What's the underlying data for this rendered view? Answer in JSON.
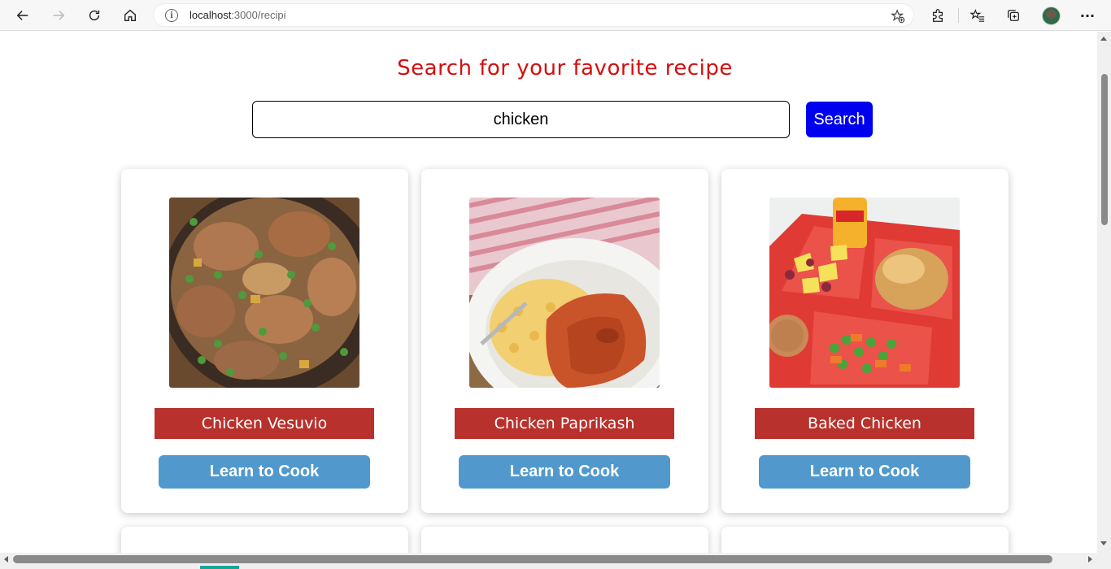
{
  "browser": {
    "url_host": "localhost",
    "url_path": ":3000/recipi",
    "nav_icons": [
      "back-arrow-icon",
      "forward-arrow-icon",
      "refresh-icon",
      "home-icon"
    ],
    "toolbar_icons": [
      "add-favorite-icon",
      "extensions-icon",
      "favorites-icon",
      "collections-icon",
      "profile-avatar",
      "more-icon"
    ],
    "more_label": "···"
  },
  "page": {
    "title": "Search for your favorite recipe",
    "title_color": "#d40f0f"
  },
  "search": {
    "value": "chicken",
    "button_label": "Search",
    "button_color": "#0000ee"
  },
  "recipes": [
    {
      "title": "Chicken Vesuvio",
      "button_label": "Learn to Cook",
      "image": "chicken-vesuvio-photo"
    },
    {
      "title": "Chicken Paprikash",
      "button_label": "Learn to Cook",
      "image": "chicken-paprikash-photo"
    },
    {
      "title": "Baked Chicken",
      "button_label": "Learn to Cook",
      "image": "baked-chicken-tray-photo"
    }
  ],
  "colors": {
    "title_bar": "#b8312c",
    "cook_button": "#5199cc"
  }
}
